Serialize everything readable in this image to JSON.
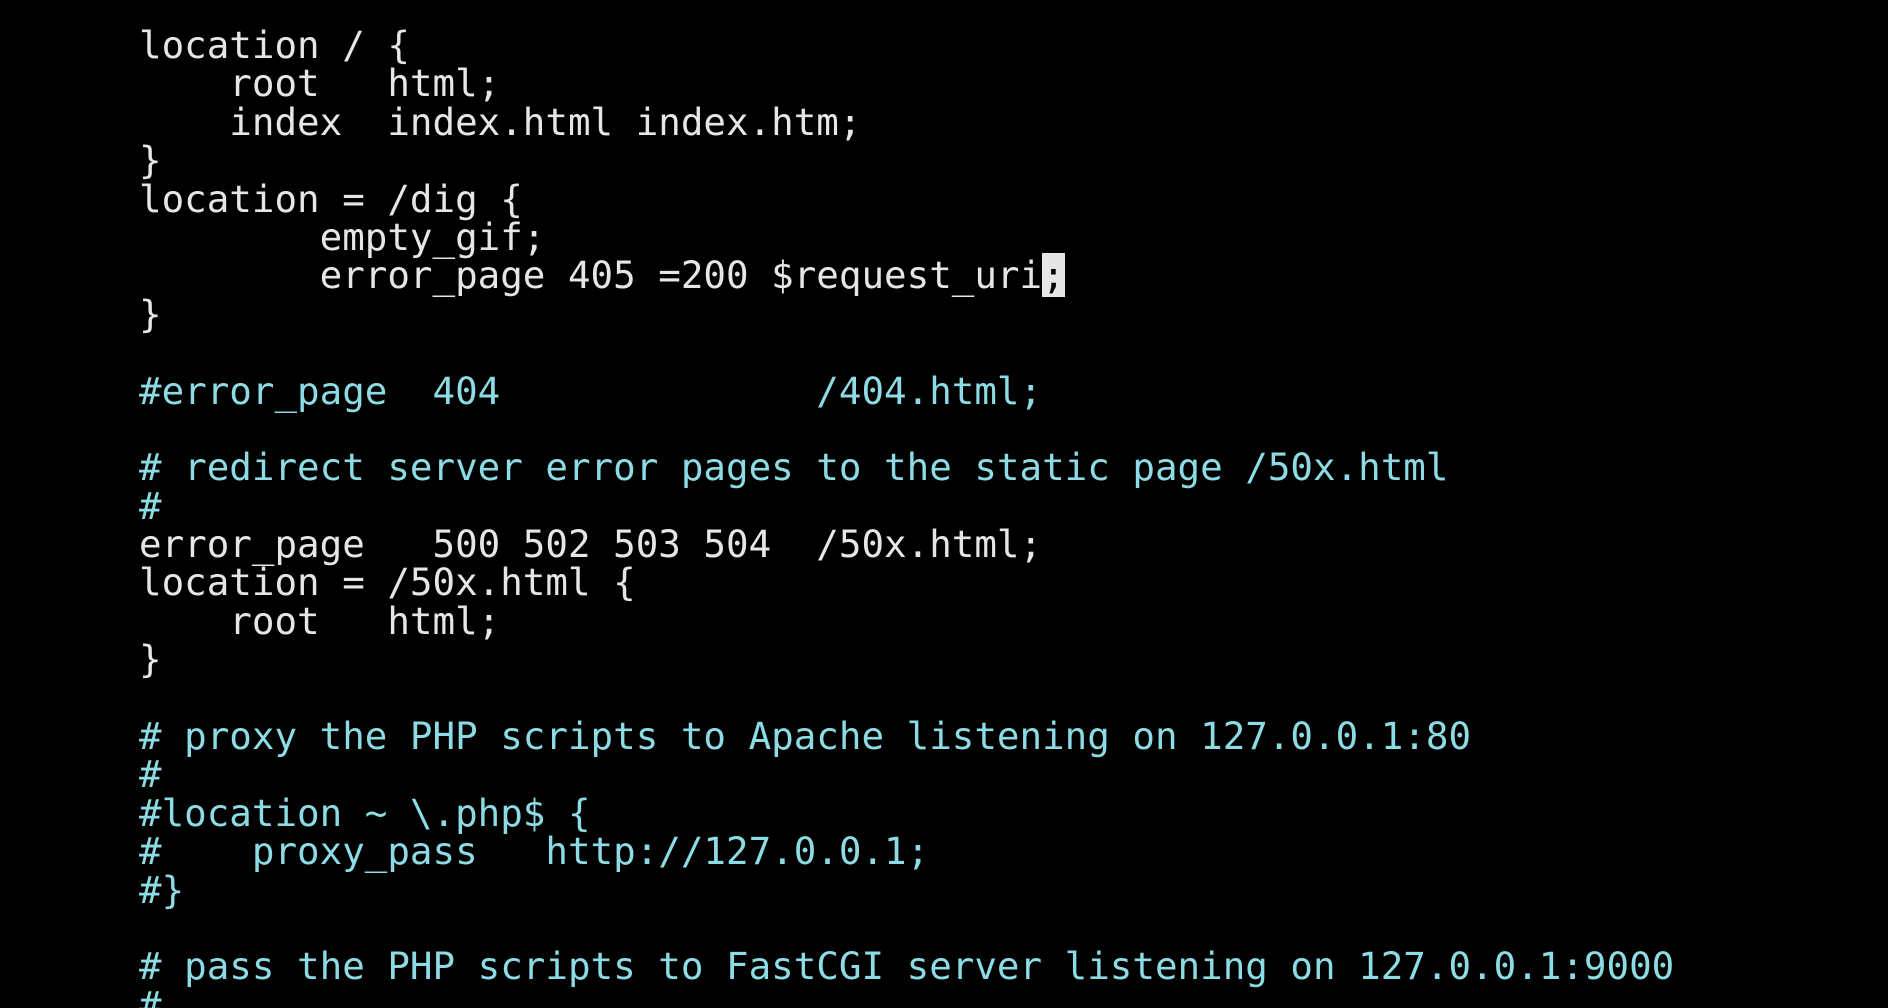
{
  "colors": {
    "background": "#000000",
    "text": "#e6e6e6",
    "comment": "#8ddbe4",
    "cursor_bg": "#e6e6e6"
  },
  "lines": [
    {
      "text": "location / {",
      "type": "plain"
    },
    {
      "text": "    root   html;",
      "type": "plain"
    },
    {
      "text": "    index  index.html index.htm;",
      "type": "plain"
    },
    {
      "text": "}",
      "type": "plain"
    },
    {
      "text": "location = /dig {",
      "type": "plain"
    },
    {
      "text": "        empty_gif;",
      "type": "plain"
    },
    {
      "text": "        error_page 405 =200 $request_uri",
      "cursor_char": ";",
      "type": "plain"
    },
    {
      "text": "}",
      "type": "plain"
    },
    {
      "text": "",
      "type": "plain"
    },
    {
      "text": "#error_page  404              /404.html;",
      "type": "comment"
    },
    {
      "text": "",
      "type": "plain"
    },
    {
      "text": "# redirect server error pages to the static page /50x.html",
      "type": "comment"
    },
    {
      "text": "#",
      "type": "comment"
    },
    {
      "text": "error_page   500 502 503 504  /50x.html;",
      "type": "plain"
    },
    {
      "text": "location = /50x.html {",
      "type": "plain"
    },
    {
      "text": "    root   html;",
      "type": "plain"
    },
    {
      "text": "}",
      "type": "plain"
    },
    {
      "text": "",
      "type": "plain"
    },
    {
      "text": "# proxy the PHP scripts to Apache listening on 127.0.0.1:80",
      "type": "comment"
    },
    {
      "text": "#",
      "type": "comment"
    },
    {
      "text": "#location ~ \\.php$ {",
      "type": "comment"
    },
    {
      "text": "#    proxy_pass   http://127.0.0.1;",
      "type": "comment"
    },
    {
      "text": "#}",
      "type": "comment"
    },
    {
      "text": "",
      "type": "plain"
    },
    {
      "text": "# pass the PHP scripts to FastCGI server listening on 127.0.0.1:9000",
      "type": "comment"
    },
    {
      "text": "#",
      "type": "comment"
    }
  ]
}
